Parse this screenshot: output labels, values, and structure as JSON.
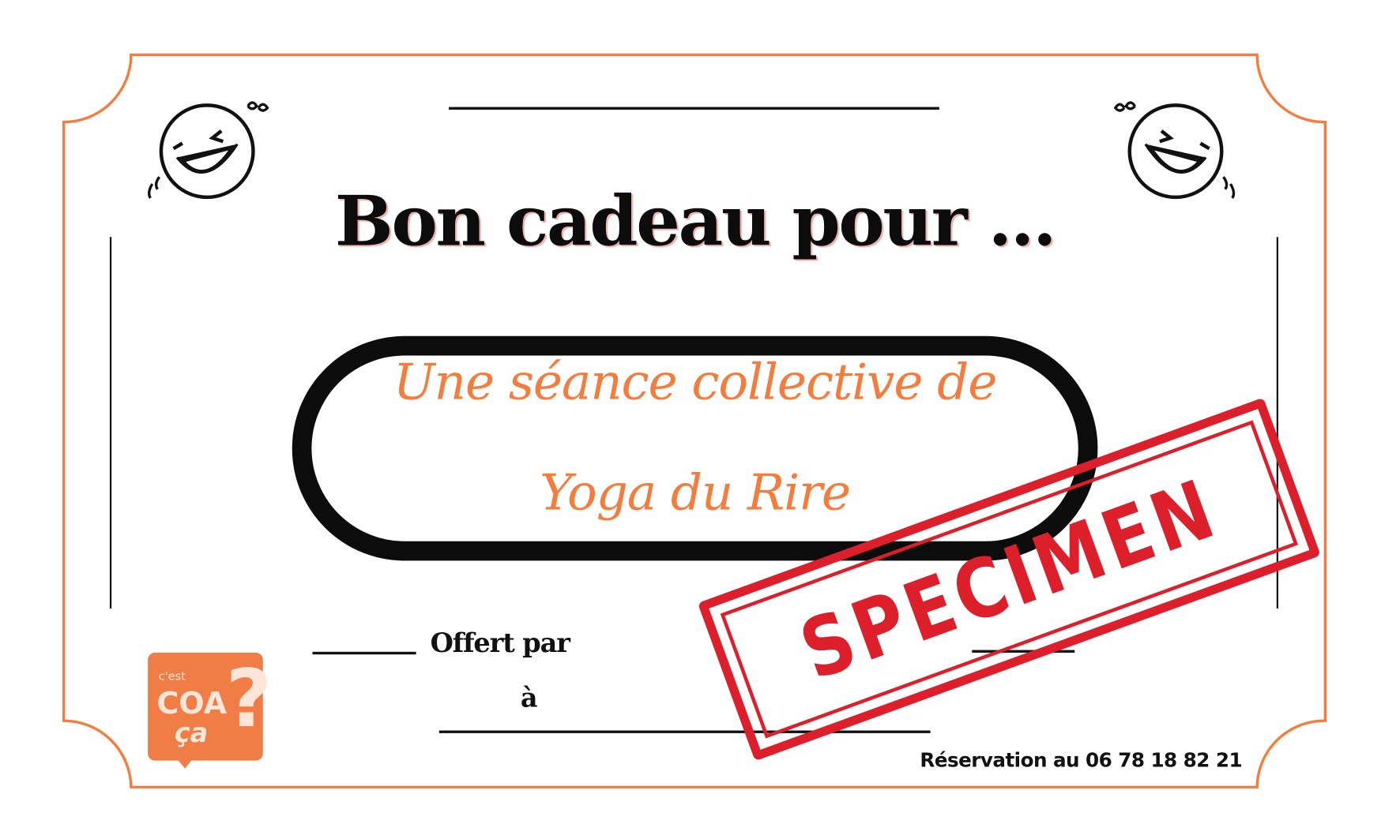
{
  "voucher": {
    "title": "Bon cadeau pour ...",
    "offer_line1": "Une séance collective de",
    "offer_line2": "Yoga du Rire",
    "offered_by_label": "Offert par",
    "to_label": "à",
    "reservation": "Réservation au 06 78 18 82 21",
    "stamp": "SPECIMEN"
  },
  "logo": {
    "small": "c'est",
    "line1": "COA",
    "line2": "ça",
    "mark": "?"
  },
  "colors": {
    "accent": "#f47c3c",
    "stamp": "#dc1f2b",
    "ink": "#0c0c0c"
  }
}
